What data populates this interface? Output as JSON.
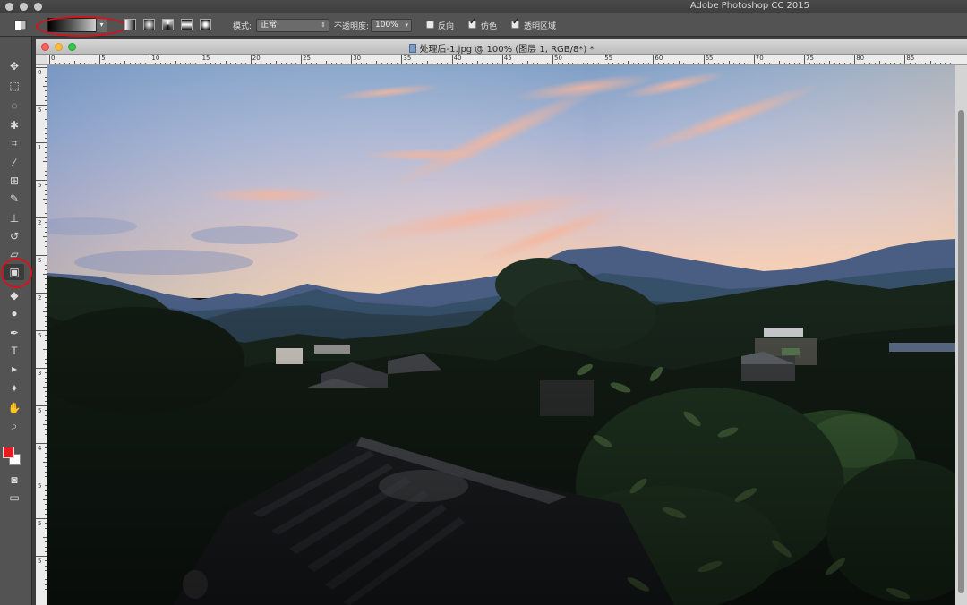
{
  "app": {
    "title": "Adobe Photoshop CC 2015"
  },
  "options_bar": {
    "mode_label": "模式:",
    "mode_value": "正常",
    "opacity_label": "不透明度:",
    "opacity_value": "100%",
    "reverse_label": "反向",
    "reverse_checked": false,
    "dither_label": "仿色",
    "dither_checked": true,
    "transparency_label": "透明区域",
    "transparency_checked": true
  },
  "document": {
    "tab_title": "处理后-1.jpg @ 100% (图层 1, RGB/8*) *"
  },
  "ruler": {
    "h_labels": [
      "0",
      "5",
      "10",
      "15",
      "20",
      "25",
      "30",
      "35",
      "40",
      "45",
      "50",
      "55",
      "60",
      "65",
      "70",
      "75",
      "80",
      "85"
    ],
    "v_labels": [
      "0",
      "5",
      "1",
      "5",
      "2",
      "5",
      "2",
      "5",
      "3",
      "5",
      "4",
      "5",
      "5",
      "5"
    ]
  },
  "tools": [
    {
      "name": "move-tool",
      "glyph": "✥"
    },
    {
      "name": "marquee-tool",
      "glyph": "⬚"
    },
    {
      "name": "lasso-tool",
      "glyph": "◌"
    },
    {
      "name": "quick-selection-tool",
      "glyph": "✱"
    },
    {
      "name": "crop-tool",
      "glyph": "⌗"
    },
    {
      "name": "eyedropper-tool",
      "glyph": "⁄"
    },
    {
      "name": "healing-brush-tool",
      "glyph": "⊞"
    },
    {
      "name": "brush-tool",
      "glyph": "✎"
    },
    {
      "name": "clone-stamp-tool",
      "glyph": "⊥"
    },
    {
      "name": "history-brush-tool",
      "glyph": "↺"
    },
    {
      "name": "eraser-tool",
      "glyph": "▱"
    },
    {
      "name": "gradient-tool",
      "glyph": "▣"
    },
    {
      "name": "blur-tool",
      "glyph": "◆"
    },
    {
      "name": "dodge-tool",
      "glyph": "●"
    },
    {
      "name": "pen-tool",
      "glyph": "✒"
    },
    {
      "name": "type-tool",
      "glyph": "T"
    },
    {
      "name": "path-selection-tool",
      "glyph": "▸"
    },
    {
      "name": "shape-tool",
      "glyph": "✦"
    },
    {
      "name": "hand-tool",
      "glyph": "✋"
    },
    {
      "name": "zoom-tool",
      "glyph": "⌕"
    }
  ],
  "colors": {
    "foreground": "#e51a23",
    "background": "#ffffff",
    "annotation_circle": "#d8121a"
  }
}
